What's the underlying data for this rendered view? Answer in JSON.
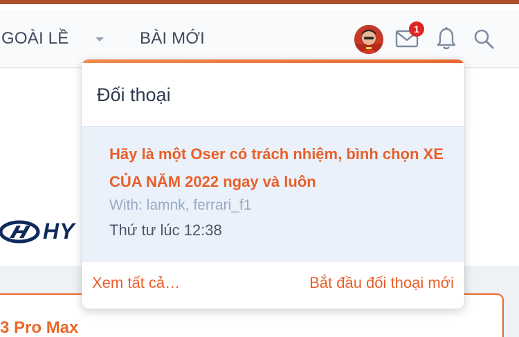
{
  "nav": {
    "items": [
      {
        "label": "GOÀI LỀ"
      },
      {
        "label": "BÀI MỚI"
      }
    ],
    "notification_badge": "1"
  },
  "dropdown": {
    "title": "Đối thoại",
    "conversation": {
      "title": "Hãy là một Oser có trách nhiệm, bình chọn XE CỦA NĂM 2022 ngay và luôn",
      "with": "With: lamnk, ferrari_f1",
      "time": "Thứ tư lúc 12:38"
    },
    "view_all": "Xem tất cả…",
    "new_conversation": "Bắt đầu đối thoại mới"
  },
  "background": {
    "brand_text": "HY",
    "card_title": "3 Pro Max"
  },
  "icons": {
    "mail": "mail-icon",
    "bell": "bell-icon",
    "search": "search-icon",
    "caret": "chevron-down-icon"
  },
  "colors": {
    "accent": "#e8602a",
    "top_stripe": "#b0502c",
    "badge": "#e02424"
  }
}
